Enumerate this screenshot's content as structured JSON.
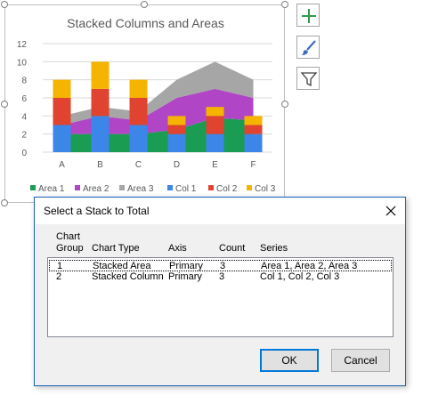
{
  "chart": {
    "title": "Stacked Columns and Areas",
    "legend": [
      "Area 1",
      "Area 2",
      "Area 3",
      "Col 1",
      "Col 2",
      "Col 3"
    ]
  },
  "colors": {
    "area1": "#1a9c53",
    "area2": "#b045c5",
    "area3": "#a6a6a6",
    "col1": "#3b86e8",
    "col2": "#e0432f",
    "col3": "#f5b400"
  },
  "chart_data": {
    "type": "bar",
    "title": "Stacked Columns and Areas",
    "categories": [
      "A",
      "B",
      "C",
      "D",
      "E",
      "F"
    ],
    "ylim": [
      0,
      12
    ],
    "yticks": [
      0,
      2,
      4,
      6,
      8,
      10,
      12
    ],
    "grid": true,
    "legend_position": "bottom",
    "area_series": [
      {
        "name": "Area 1",
        "values": [
          2,
          2,
          2,
          2.5,
          3.8,
          3.5
        ]
      },
      {
        "name": "Area 2",
        "values": [
          1,
          2,
          1.5,
          3.5,
          3.2,
          2.5
        ]
      },
      {
        "name": "Area 3",
        "values": [
          1,
          1,
          1,
          2,
          3,
          2
        ]
      }
    ],
    "column_series": [
      {
        "name": "Col 1",
        "values": [
          3,
          4,
          3,
          2,
          2,
          2
        ]
      },
      {
        "name": "Col 2",
        "values": [
          3,
          3,
          3,
          1,
          2,
          1
        ]
      },
      {
        "name": "Col 3",
        "values": [
          2,
          3,
          2,
          1,
          1,
          1
        ]
      }
    ]
  },
  "side_buttons": [
    "chart-elements-icon",
    "chart-styles-icon",
    "chart-filters-icon"
  ],
  "dialog": {
    "title": "Select a Stack to Total",
    "close_glyph": "✕",
    "headers": {
      "group_line1": "Chart",
      "group_line2": "Group",
      "type": "Chart Type",
      "axis": "Axis",
      "count": "Count",
      "series": "Series"
    },
    "rows": [
      {
        "group": "1",
        "type": "Stacked Area",
        "axis": "Primary",
        "count": "3",
        "series": "Area 1, Area 2, Area 3"
      },
      {
        "group": "2",
        "type": "Stacked Column",
        "axis": "Primary",
        "count": "3",
        "series": "Col 1, Col 2, Col 3"
      }
    ],
    "ok_label": "OK",
    "cancel_label": "Cancel"
  }
}
